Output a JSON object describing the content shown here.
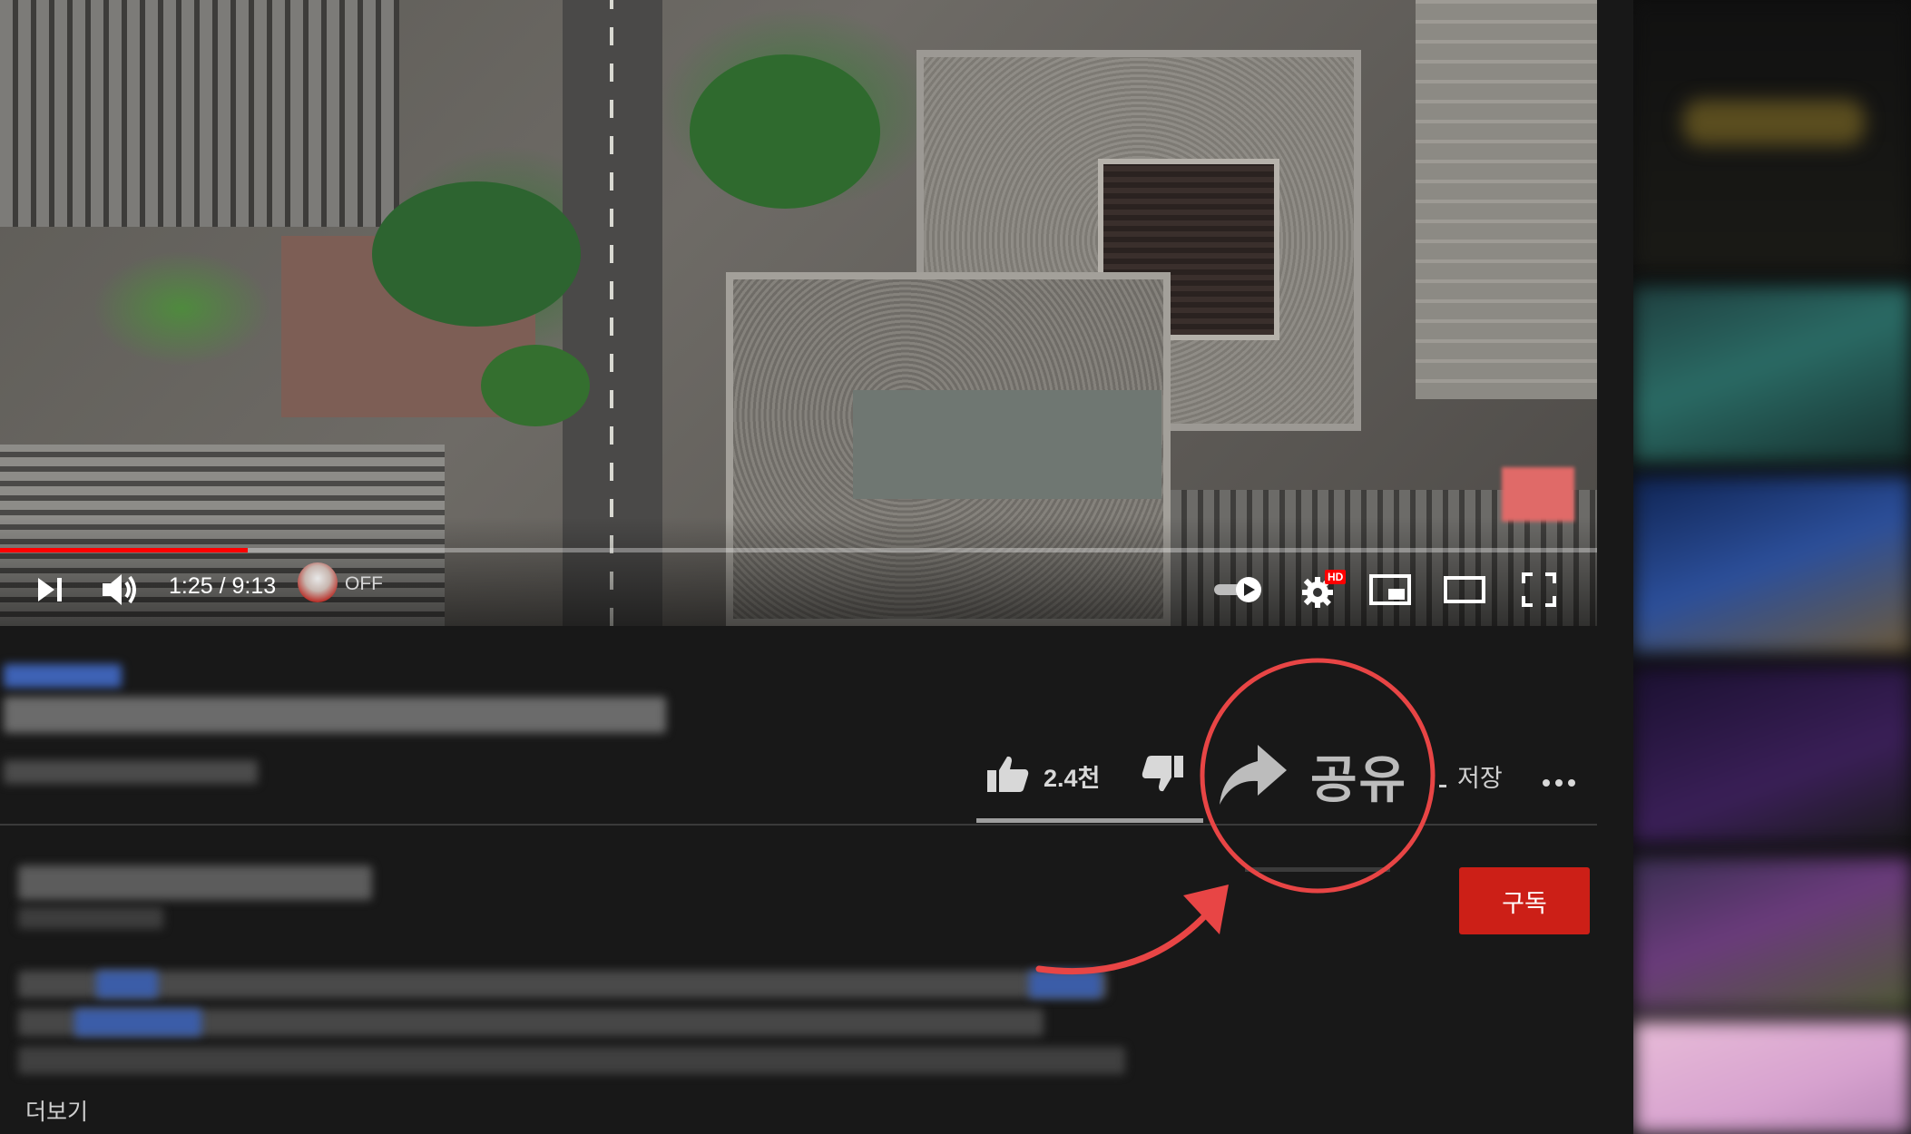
{
  "player": {
    "time_display": "1:25 / 9:13",
    "autonav_state": "OFF",
    "progress_fraction": 0.155,
    "hd_badge": "HD",
    "icons": {
      "next": "skip-next-icon",
      "volume": "volume-icon",
      "autoplay": "autoplay-toggle-icon",
      "settings": "settings-gear-icon",
      "miniplayer": "miniplayer-icon",
      "theater": "theater-mode-icon",
      "fullscreen": "fullscreen-icon"
    }
  },
  "actions": {
    "like_count": "2.4천",
    "share_label": "공유",
    "save_label": "저장",
    "icons": {
      "like": "thumbs-up-icon",
      "dislike": "thumbs-down-icon",
      "share": "share-arrow-icon",
      "save": "save-playlist-icon",
      "more": "more-horizontal-icon"
    }
  },
  "channel": {
    "subscribe_label": "구독"
  },
  "description": {
    "more_label": "더보기"
  },
  "annotation": {
    "color": "#e84545"
  },
  "colors": {
    "background": "#181818",
    "progress": "#ff0000",
    "subscribe": "#cc1f17",
    "hd_badge": "#ff0000"
  }
}
